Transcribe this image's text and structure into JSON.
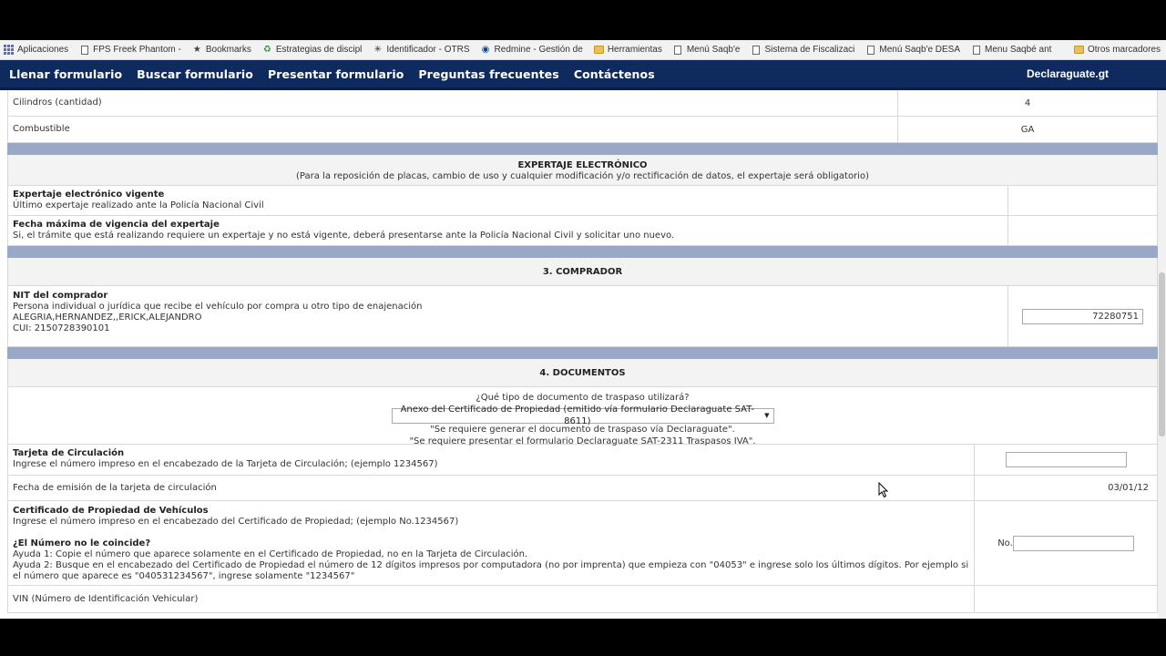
{
  "bookmarks": [
    {
      "label": "Aplicaciones",
      "icon": "apps-icon"
    },
    {
      "label": "FPS Freek Phantom -",
      "icon": "page-icon"
    },
    {
      "label": "Bookmarks",
      "icon": "star-icon"
    },
    {
      "label": "Estrategias de discipl",
      "icon": "recycle-icon"
    },
    {
      "label": "Identificador - OTRS",
      "icon": "star-burst-icon"
    },
    {
      "label": "Redmine - Gestión de",
      "icon": "redmine-icon"
    },
    {
      "label": "Herramientas",
      "icon": "folder-icon"
    },
    {
      "label": "Menú Saqb'e",
      "icon": "page-icon"
    },
    {
      "label": "Sistema de Fiscalizaci",
      "icon": "page-icon"
    },
    {
      "label": "Menú Saqb'e DESA",
      "icon": "page-icon"
    },
    {
      "label": "Menu Saqbé ant",
      "icon": "page-icon"
    }
  ],
  "bookmarks_other": "Otros marcadores",
  "nav": {
    "links": [
      "Llenar formulario",
      "Buscar formulario",
      "Presentar formulario",
      "Preguntas frecuentes",
      "Contáctenos"
    ],
    "brand": "Declaraguate.gt"
  },
  "vehicle": {
    "cylinders_label": "Cilindros (cantidad)",
    "cylinders_value": "4",
    "fuel_label": "Combustible",
    "fuel_value": "GA"
  },
  "expertaje": {
    "title": "EXPERTAJE ELECTRÓNICO",
    "subtitle": "(Para la reposición de placas, cambio de uso y cualquier modificación y/o rectificación de datos, el expertaje será obligatorio)",
    "vigente_title": "Expertaje electrónico vigente",
    "vigente_desc": "Último expertaje realizado ante la Policía Nacional Civil",
    "fecha_title": "Fecha máxima de vigencia del expertaje",
    "fecha_desc": "Si, el trámite que está realizando requiere un expertaje y no está vigente, deberá presentarse ante la Policía Nacional Civil y solicitar uno nuevo."
  },
  "comprador": {
    "title": "3. COMPRADOR",
    "nit_title": "NIT del comprador",
    "nit_desc": "Persona individual o jurídica que recibe el vehículo por compra u otro tipo de enajenación",
    "name": "ALEGRIA,HERNANDEZ,,ERICK,ALEJANDRO",
    "cui": "CUI: 2150728390101",
    "nit_value": "72280751"
  },
  "documentos": {
    "title": "4. DOCUMENTOS",
    "question": "¿Qué tipo de documento de traspaso utilizará?",
    "selected": "Anexo del Certificado de Propiedad (emitido vía formulario Declaraguate SAT-8611)",
    "note1": "\"Se requiere generar el documento de traspaso vía Declaraguate\".",
    "note2": "\"Se requiere presentar el formulario Declaraguate SAT-2311 Traspasos IVA\".",
    "tarjeta_title": "Tarjeta de Circulación",
    "tarjeta_desc": "Ingrese el número impreso en el encabezado de la Tarjeta de Circulación; (ejemplo 1234567)",
    "tarjeta_value": "",
    "fecha_emision_label": "Fecha de emisión de la tarjeta de circulación",
    "fecha_emision_value": "03/01/12",
    "cert_title": "Certificado de Propiedad de Vehículos",
    "cert_desc": "Ingrese el número impreso en el encabezado del Certificado de Propiedad; (ejemplo No.1234567)",
    "nomatch_title": "¿El Número no le coincide?",
    "ayuda1": "Ayuda 1: Copie el número que aparece solamente en el Certificado de Propiedad, no en la Tarjeta de Circulación.",
    "ayuda2": "Ayuda 2: Busque en el encabezado del Certificado de Propiedad el número de 12 dígitos impresos por computadora (no por imprenta) que empieza con \"04053\" e ingrese solo los últimos dígitos. Por ejemplo si el número que aparece es \"040531234567\", ingrese solamente \"1234567\"",
    "no_prefix": "No.",
    "cert_value": "",
    "vin_label": "VIN (Número de Identificación Vehicular)"
  }
}
